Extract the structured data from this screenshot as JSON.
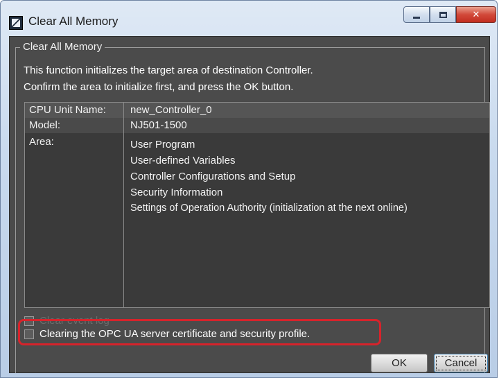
{
  "window": {
    "title": "Clear All Memory"
  },
  "group": {
    "legend": "Clear All Memory",
    "description_line1": "This function initializes the target area of destination Controller.",
    "description_line2": "Confirm the area to initialize first, and press the OK button."
  },
  "info": {
    "cpu_unit_name_label": "CPU Unit Name:",
    "cpu_unit_name_value": "new_Controller_0",
    "model_label": "Model:",
    "model_value": "NJ501-1500",
    "area_label": "Area:",
    "area_items": [
      "User Program",
      "User-defined Variables",
      "Controller Configurations and Setup",
      "Security Information",
      "Settings of Operation Authority (initialization at the next online)"
    ]
  },
  "options": {
    "clear_event_log_label": "Clear event log",
    "clear_opc_label": "Clearing the OPC UA server certificate and security profile."
  },
  "buttons": {
    "ok_label": "OK",
    "cancel_label": "Cancel"
  }
}
